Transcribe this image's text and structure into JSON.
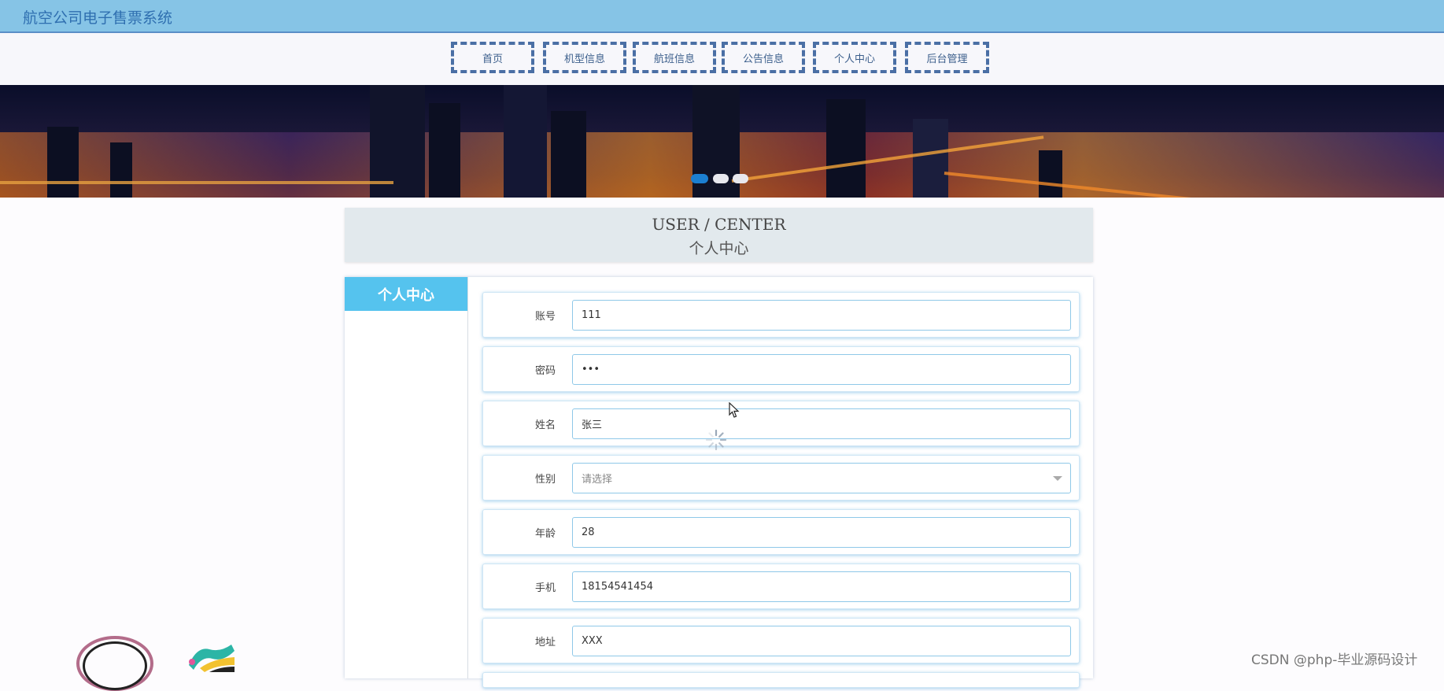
{
  "app": {
    "title": "航空公司电子售票系统"
  },
  "nav": {
    "items": [
      {
        "label": "首页"
      },
      {
        "label": "机型信息"
      },
      {
        "label": "航班信息"
      },
      {
        "label": "公告信息"
      },
      {
        "label": "个人中心"
      },
      {
        "label": "后台管理"
      }
    ]
  },
  "banner": {
    "slide_count": 3,
    "active_slide": 1
  },
  "section": {
    "title_en": "USER / CENTER",
    "title_cn": "个人中心"
  },
  "sidebar": {
    "active_tab": "个人中心"
  },
  "form": {
    "fields": [
      {
        "label": "账号",
        "value": "111"
      },
      {
        "label": "密码",
        "value": "•••"
      },
      {
        "label": "姓名",
        "value": "张三"
      },
      {
        "label": "性别",
        "value": "",
        "placeholder": "请选择"
      },
      {
        "label": "年龄",
        "value": "28"
      },
      {
        "label": "手机",
        "value": "18154541454"
      },
      {
        "label": "地址",
        "value": "XXX"
      }
    ]
  },
  "watermark": "CSDN @php-毕业源码设计",
  "colors": {
    "accent": "#55c3ee",
    "header": "#86c4e6",
    "nav_border": "#4a6fa5"
  }
}
